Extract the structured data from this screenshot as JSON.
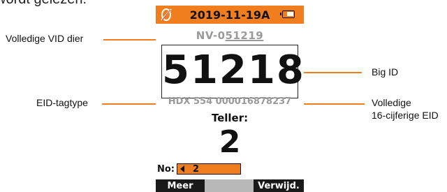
{
  "page": {
    "heading_fragment": "wordt gelezen."
  },
  "device": {
    "date": "2019-11-19A",
    "vid_prefix": "NV-0",
    "vid_underlined": "51219",
    "big_id": "51218",
    "eid": "HDX 554 000016878237",
    "counter_label": "Teller:",
    "counter_value": "2",
    "no_label": "No:",
    "no_value": "2",
    "softkeys": {
      "left": "Meer",
      "middle": "",
      "right": "Verwijd."
    },
    "icons": {
      "status": "satellite-off-icon",
      "battery": "battery-icon",
      "no_arrow": "left-arrow-icon"
    }
  },
  "callouts": {
    "vid": "Volledige VID dier",
    "eid_type": "EID-tagtype",
    "big_id": "Big ID",
    "full_eid_line1": "Volledige",
    "full_eid_line2": "16-cijferige EID"
  },
  "colors": {
    "accent": "#f07e1e",
    "dimmed_text": "#9a9a9a",
    "softkey_bg": "#1a1a1a",
    "softkey_middle_bg": "#b8b8b8"
  }
}
